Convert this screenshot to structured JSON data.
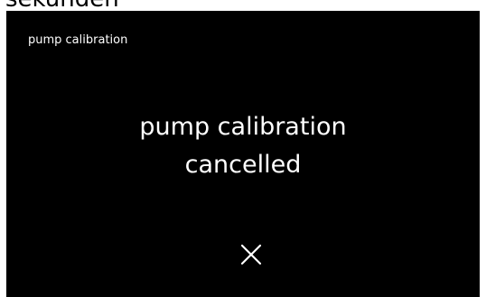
{
  "overlay_caption": "sekunden",
  "screen": {
    "title": "pump calibration",
    "message_line1": "pump calibration",
    "message_line2": "cancelled",
    "close_icon": "close-icon",
    "colors": {
      "background": "#000000",
      "text": "#ffffff"
    }
  }
}
